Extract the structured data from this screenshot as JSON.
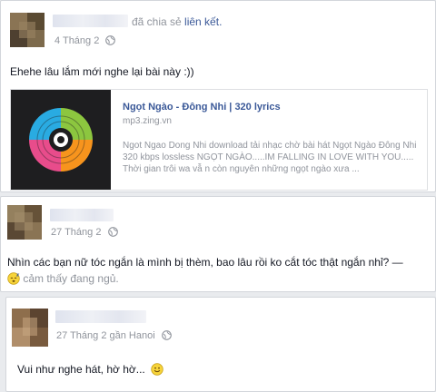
{
  "post1": {
    "share_prefix": "đã chia sẻ",
    "share_link": "liên kết.",
    "time": "4 Tháng 2",
    "text": "Ehehe lâu lắm mới nghe lại bài này :))",
    "card": {
      "title": "Ngọt Ngào - Đông Nhi | 320 lyrics",
      "domain": "mp3.zing.vn",
      "desc_line1": "Ngot Ngao Dong Nhi download tải nhạc chờ bài hát Ngọt Ngào Đông Nhi",
      "desc_line2": "320 kbps lossless NGỌT NGÀO.....IM FALLING IN LOVE WITH YOU.....",
      "desc_line3": "Thời gian trôi wa vẫ n còn nguyên những ngọt ngào xưa ..."
    }
  },
  "post2": {
    "time": "27 Tháng 2",
    "text_line1": "Nhìn các bạn nữ tóc ngắn là mình bị thèm, bao lâu rồi ko cắt tóc thật ngắn nhỉ? —",
    "feeling": "cảm thấy đang ngủ."
  },
  "post3": {
    "time": "27 Tháng 2 gần Hanoi",
    "text": "Vui như nghe hát, hờ hờ..."
  },
  "colors": {
    "link": "#3b5998",
    "meta": "#90949c",
    "background": "#e9ebee"
  },
  "icons": [
    "globe-icon",
    "sleepy-emoji-icon",
    "smile-emoji-icon"
  ]
}
